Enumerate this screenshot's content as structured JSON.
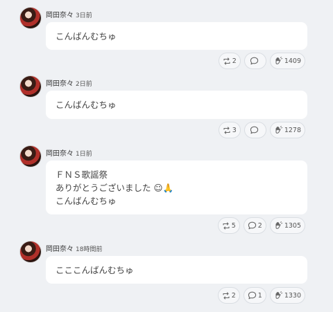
{
  "posts": [
    {
      "author": "岡田奈々",
      "time": "3日前",
      "lines": [
        "こんばんむちゅ"
      ],
      "retweets": "2",
      "replies": "",
      "likes": "1409"
    },
    {
      "author": "岡田奈々",
      "time": "2日前",
      "lines": [
        "こんばんむちゅ"
      ],
      "retweets": "3",
      "replies": "",
      "likes": "1278"
    },
    {
      "author": "岡田奈々",
      "time": "1日前",
      "lines": [
        "ＦＮＳ歌謡祭",
        "ありがとうございました ☺🙏",
        "こんばんむちゅ"
      ],
      "retweets": "5",
      "replies": "2",
      "likes": "1305"
    },
    {
      "author": "岡田奈々",
      "time": "18時間前",
      "lines": [
        "こここんばんむちゅ"
      ],
      "retweets": "2",
      "replies": "1",
      "likes": "1330"
    }
  ],
  "icons": {
    "avatar": "avatar",
    "retweet": "retweet-icon",
    "reply": "reply-icon",
    "like": "clap-icon"
  }
}
